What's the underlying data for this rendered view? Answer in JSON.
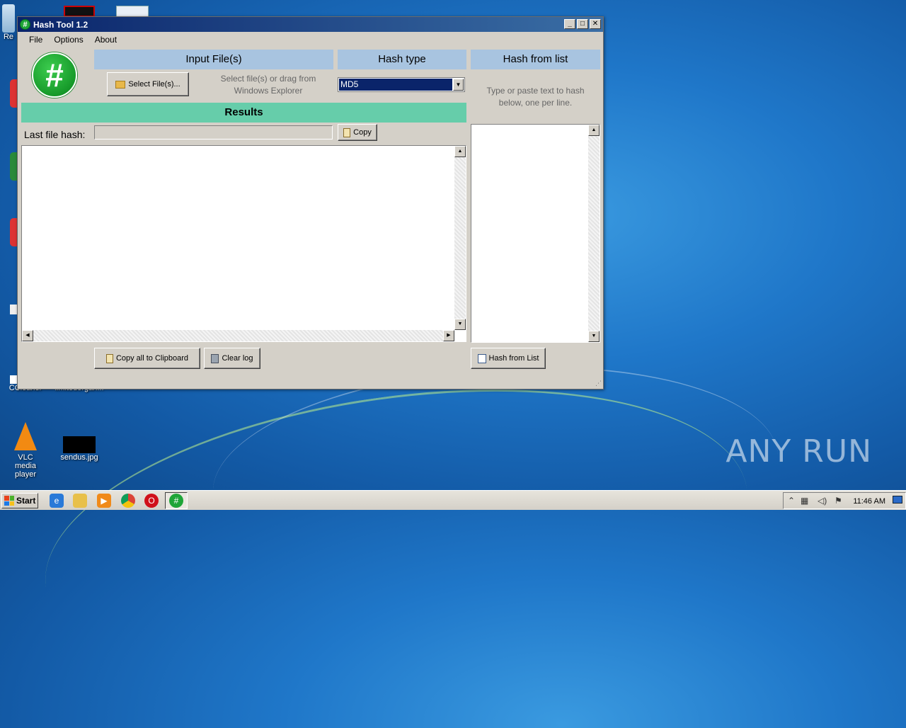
{
  "desktop": {
    "icons": [
      {
        "label": "Re"
      },
      {
        "label": "CCleaner"
      },
      {
        "label": "limitedorgan..."
      },
      {
        "label": "VLC media player"
      },
      {
        "label": "sendus.jpg"
      }
    ],
    "watermark": "ANY RUN"
  },
  "window": {
    "title": "Hash Tool 1.2",
    "controls": {
      "minimize": "_",
      "maximize": "□",
      "close": "✕"
    },
    "menu": [
      "File",
      "Options",
      "About"
    ],
    "input_files": {
      "header": "Input File(s)",
      "select_button": "Select File(s)...",
      "hint_line1": "Select file(s) or drag from",
      "hint_line2": "Windows Explorer"
    },
    "hash_type": {
      "header": "Hash type",
      "selected": "MD5"
    },
    "hash_from_list": {
      "header": "Hash from list",
      "hint_line1": "Type or paste text to hash",
      "hint_line2": "below, one per line.",
      "button": "Hash from List"
    },
    "results": {
      "header": "Results",
      "last_hash_label": "Last file hash:",
      "last_hash_value": "",
      "copy_button": "Copy",
      "copy_all_button": "Copy all to Clipboard",
      "clear_button": "Clear log"
    }
  },
  "taskbar": {
    "start_label": "Start",
    "clock": "11:46 AM"
  }
}
